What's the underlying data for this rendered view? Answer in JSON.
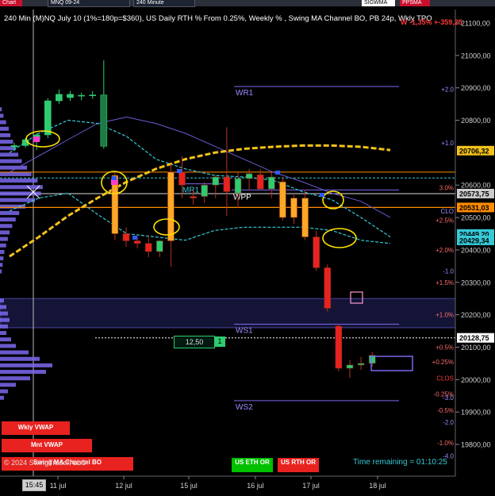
{
  "toolbar": {
    "chart_tab": "Chart",
    "symbol": "MNQ 09-24",
    "interval": "240 Minute",
    "study_button": "SIGWMA",
    "pps_button": "PPSMA"
  },
  "header": {
    "title": "240 Min (M)NQ July 10 (1%=180p=$360), US Daily RTH % From 0.25%, Weekly % , Swing MA Channel BO, PB 24p, Wkly TPO",
    "pnl": "W -1,35% +-359,25"
  },
  "footer": {
    "copyright": "© 2024 SwingTrader, LLC",
    "time_remaining": "Time remaining = 01:10:25",
    "time_box": "15:45"
  },
  "buttons": {
    "wkly_vwap": "Wkly VWAP",
    "mnt_vwap": "Mnt VWAP",
    "swing_ma": "Swing MA Channel BO",
    "us_eth_or": "US ETH OR",
    "us_rth_or": "US RTH OR"
  },
  "order_box": {
    "value": "12,50",
    "qty": "1"
  },
  "colors": {
    "background": "#000000",
    "bull_candle": "#2ecc71",
    "bear_candle": "#e8231f",
    "orange_candle": "#ffa726",
    "ma_yellow": "#f2c21a",
    "channel_cyan": "#36c9d6",
    "purple_line": "#6a5acd",
    "profile": "#7b68ee"
  },
  "chart_data": {
    "type": "candlestick",
    "title": "240 Min (M)NQ July 10 (1%=180p=$360), US Daily RTH % From 0.25%, Weekly % , Swing MA Channel BO, PB 24p, Wkly TPO",
    "y_range": [
      19740,
      21120
    ],
    "y_ticks": [
      "21100,00",
      "21000,00",
      "20900,00",
      "20800,00",
      "20600,00",
      "20500,00",
      "20400,00",
      "20300,00",
      "20200,00",
      "20100,00",
      "20000,00",
      "19900,00",
      "19800,00"
    ],
    "x_ticks": [
      "11 jul",
      "12 jul",
      "15 jul",
      "16 jul",
      "17 jul",
      "18 jul"
    ],
    "price_labels": [
      {
        "text": "20706,32",
        "value": 20706.32,
        "color": "#f2c21a"
      },
      {
        "text": "20573,75",
        "value": 20573.75,
        "color": "#cccccc"
      },
      {
        "text": "20531,03",
        "value": 20531.03,
        "color": "#ff8c00"
      },
      {
        "text": "20449,20",
        "value": 20449.2,
        "color": "#36c9d6"
      },
      {
        "text": "20429,34",
        "value": 20429.34,
        "color": "#36c9d6"
      },
      {
        "text": "20128,75",
        "value": 20128.75,
        "color": "#ffffff"
      }
    ],
    "percent_labels": [
      {
        "text": "+2.0",
        "value": 20895,
        "color": "#9b8cff"
      },
      {
        "text": "+1.0",
        "value": 20730,
        "color": "#9b8cff"
      },
      {
        "text": "3.0%",
        "value": 20592,
        "color": "#ff6b6b"
      },
      {
        "text": "CLO",
        "value": 20520,
        "color": "#9b8cff"
      },
      {
        "text": "+2.5%",
        "value": 20492,
        "color": "#ff6b6b"
      },
      {
        "text": "+2.0%",
        "value": 20400,
        "color": "#ff6b6b"
      },
      {
        "text": "-1.0",
        "value": 20335,
        "color": "#9b8cff"
      },
      {
        "text": "+1.5%",
        "value": 20300,
        "color": "#ff6b6b"
      },
      {
        "text": "+1.0%",
        "value": 20200,
        "color": "#ff6b6b"
      },
      {
        "text": "+0.5%",
        "value": 20100,
        "color": "#ff6b6b"
      },
      {
        "text": "+0.25%",
        "value": 20055,
        "color": "#ff6b6b"
      },
      {
        "text": "CLOS",
        "value": 20005,
        "color": "#ff3b3b"
      },
      {
        "text": "-0.25%",
        "value": 19955,
        "color": "#ff6b6b"
      },
      {
        "text": "-3.0",
        "value": 19945,
        "color": "#9b8cff"
      },
      {
        "text": "-0.5%",
        "value": 19905,
        "color": "#ff6b6b"
      },
      {
        "text": "-1.0%",
        "value": 19805,
        "color": "#ff6b6b"
      },
      {
        "text": "-4.0",
        "value": 19765,
        "color": "#9b8cff"
      },
      {
        "text": "-2.0",
        "value": 19868,
        "color": "#9b8cff"
      }
    ],
    "levels": [
      {
        "label": "WR1",
        "value": 20904
      },
      {
        "label": "MR1",
        "value": 20604
      },
      {
        "label": "WPP",
        "value": 20585
      },
      {
        "label": "WS1",
        "value": 20171
      },
      {
        "label": "WS2",
        "value": 19935
      }
    ],
    "candles": [
      {
        "o": 20718,
        "h": 20730,
        "l": 20705,
        "c": 20722
      },
      {
        "o": 20722,
        "h": 20745,
        "l": 20715,
        "c": 20740
      },
      {
        "o": 20738,
        "h": 20760,
        "l": 20708,
        "c": 20755
      },
      {
        "o": 20755,
        "h": 20868,
        "l": 20745,
        "c": 20860
      },
      {
        "o": 20860,
        "h": 20895,
        "l": 20850,
        "c": 20880
      },
      {
        "o": 20870,
        "h": 20890,
        "l": 20860,
        "c": 20880
      },
      {
        "o": 20875,
        "h": 20885,
        "l": 20862,
        "c": 20877
      },
      {
        "o": 20876,
        "h": 20890,
        "l": 20866,
        "c": 20878
      },
      {
        "o": 20878,
        "h": 20985,
        "l": 20712,
        "c": 20720
      },
      {
        "o": 20630,
        "h": 20640,
        "l": 20430,
        "c": 20450
      },
      {
        "o": 20450,
        "h": 20470,
        "l": 20410,
        "c": 20428
      },
      {
        "o": 20428,
        "h": 20440,
        "l": 20405,
        "c": 20420
      },
      {
        "o": 20420,
        "h": 20445,
        "l": 20378,
        "c": 20395
      },
      {
        "o": 20395,
        "h": 20430,
        "l": 20378,
        "c": 20428
      },
      {
        "o": 20428,
        "h": 20665,
        "l": 20348,
        "c": 20640
      },
      {
        "o": 20640,
        "h": 20690,
        "l": 20560,
        "c": 20600
      },
      {
        "o": 20565,
        "h": 20585,
        "l": 20540,
        "c": 20560
      },
      {
        "o": 20565,
        "h": 20610,
        "l": 20545,
        "c": 20600
      },
      {
        "o": 20600,
        "h": 20630,
        "l": 20560,
        "c": 20625
      },
      {
        "o": 20625,
        "h": 20778,
        "l": 20505,
        "c": 20580
      },
      {
        "o": 20575,
        "h": 20640,
        "l": 20530,
        "c": 20620
      },
      {
        "o": 20620,
        "h": 20650,
        "l": 20585,
        "c": 20635
      },
      {
        "o": 20632,
        "h": 20650,
        "l": 20585,
        "c": 20588
      },
      {
        "o": 20588,
        "h": 20640,
        "l": 20560,
        "c": 20625
      },
      {
        "o": 20610,
        "h": 20625,
        "l": 20490,
        "c": 20500
      },
      {
        "o": 20500,
        "h": 20570,
        "l": 20480,
        "c": 20560
      },
      {
        "o": 20560,
        "h": 20585,
        "l": 20430,
        "c": 20440
      },
      {
        "o": 20440,
        "h": 20460,
        "l": 20335,
        "c": 20345
      },
      {
        "o": 20345,
        "h": 20355,
        "l": 20210,
        "c": 20220
      },
      {
        "o": 20165,
        "h": 20170,
        "l": 20025,
        "c": 20035
      },
      {
        "o": 20035,
        "h": 20060,
        "l": 20005,
        "c": 20045
      },
      {
        "o": 20045,
        "h": 20070,
        "l": 20030,
        "c": 20050
      },
      {
        "o": 20050,
        "h": 20085,
        "l": 20040,
        "c": 20075
      }
    ],
    "ma_yellow": [
      20380,
      20440,
      20505,
      20560,
      20610,
      20650,
      20680,
      20700,
      20712,
      20718,
      20722,
      20722,
      20718,
      20708
    ],
    "channel_upper": [
      20700,
      20760,
      20800,
      20790,
      20750,
      20680,
      20650,
      20630,
      20625,
      20615,
      20580,
      20555,
      20500,
      20440
    ],
    "channel_lower": [
      20520,
      20560,
      20575,
      20510,
      20450,
      20440,
      20430,
      20460,
      20470,
      20470,
      20470,
      20460,
      20430,
      20420
    ],
    "slow_ma": [
      20640,
      20690,
      20740,
      20790,
      20810,
      20790,
      20760,
      20720,
      20680,
      20640,
      20610,
      20575,
      20550,
      20500
    ],
    "grid": false
  }
}
